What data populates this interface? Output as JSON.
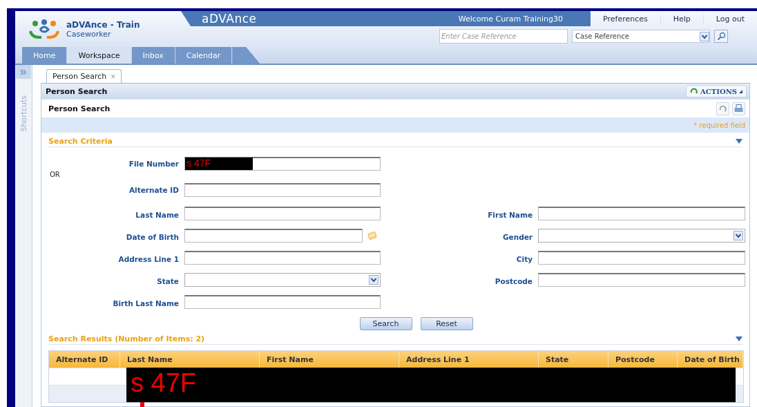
{
  "header": {
    "app_title": "aDVAnce - Train",
    "role": "Caseworker",
    "brand": "aDVAnce",
    "welcome": "Welcome Curam Training30",
    "links": [
      "Preferences",
      "Help",
      "Log out"
    ],
    "case_search": {
      "placeholder": "Enter Case Reference",
      "type_value": "Case Reference"
    }
  },
  "nav_tabs": [
    {
      "label": "Home",
      "selected": false
    },
    {
      "label": "Workspace",
      "selected": true
    },
    {
      "label": "Inbox",
      "selected": false
    },
    {
      "label": "Calendar",
      "selected": false
    }
  ],
  "shortcuts_label": "Shortcuts",
  "page_tabs": [
    {
      "label": "Person Search",
      "close": "×",
      "selected": true
    }
  ],
  "panel_title": "Person Search",
  "actions_label": "ACTIONS",
  "page_title": "Person Search",
  "required_note": "* required field",
  "criteria": {
    "title": "Search Criteria",
    "file_number": {
      "label": "File Number",
      "redaction": "s 47F"
    },
    "or_text": "OR",
    "alternate_id": {
      "label": "Alternate ID"
    },
    "left_fields": [
      {
        "label": "Last Name",
        "kind": "text"
      },
      {
        "label": "Date of Birth",
        "kind": "date"
      },
      {
        "label": "Address Line 1",
        "kind": "text"
      },
      {
        "label": "State",
        "kind": "select"
      },
      {
        "label": "Birth Last Name",
        "kind": "text"
      }
    ],
    "right_fields": [
      {
        "label": "First Name",
        "kind": "text"
      },
      {
        "label": "Gender",
        "kind": "select"
      },
      {
        "label": "City",
        "kind": "text"
      },
      {
        "label": "Postcode",
        "kind": "text"
      }
    ]
  },
  "buttons": [
    "Search",
    "Reset"
  ],
  "results": {
    "title": "Search Results (Number of Items: 2)",
    "columns": [
      "Alternate ID",
      "Last Name",
      "First Name",
      "Address Line 1",
      "State",
      "Postcode",
      "Date of Birth"
    ],
    "redaction": "s 47F"
  }
}
